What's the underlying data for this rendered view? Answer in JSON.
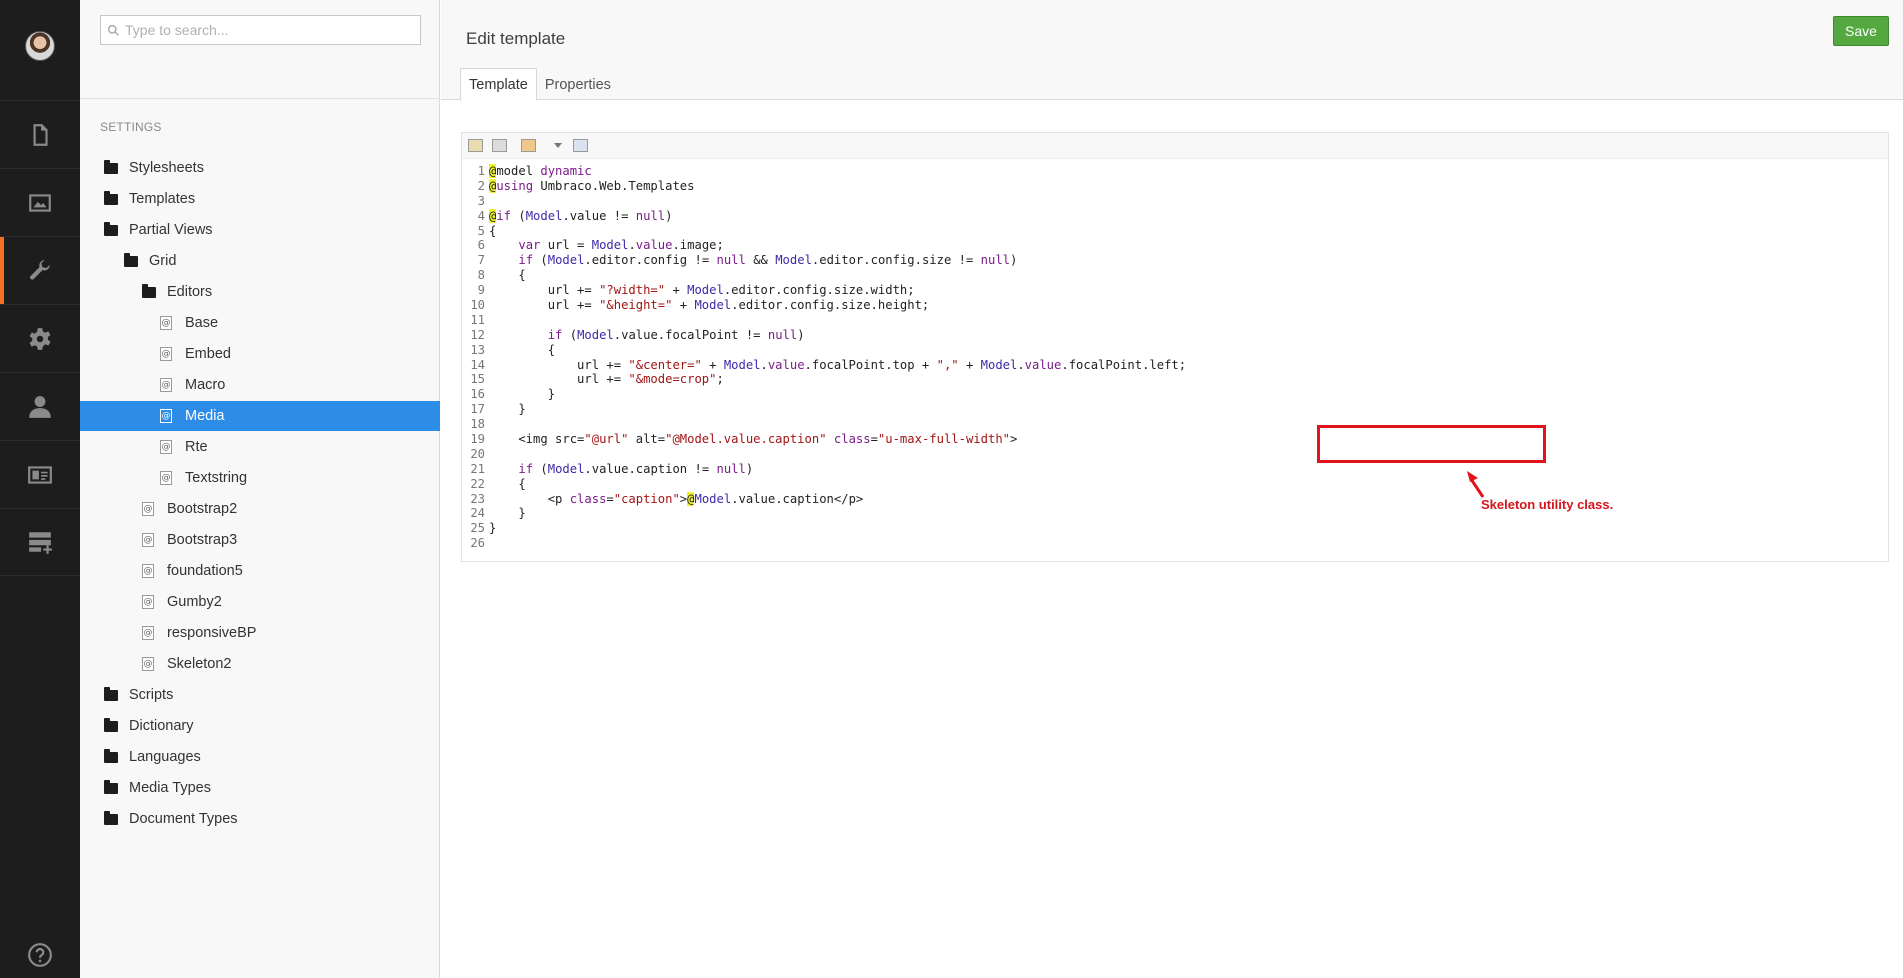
{
  "rail": {
    "items": [
      {
        "name": "content-icon"
      },
      {
        "name": "media-icon"
      },
      {
        "name": "settings-wrench-icon"
      },
      {
        "name": "developer-gear-icon"
      },
      {
        "name": "users-icon"
      },
      {
        "name": "members-icon"
      },
      {
        "name": "forms-icon"
      }
    ],
    "active_index": 2,
    "help_icon": "help-icon",
    "accent_color": "#f36f21"
  },
  "tree": {
    "search_placeholder": "Type to search...",
    "section_title": "SETTINGS",
    "items": [
      {
        "label": "Stylesheets",
        "type": "folder",
        "depth": 0
      },
      {
        "label": "Templates",
        "type": "folder",
        "depth": 0
      },
      {
        "label": "Partial Views",
        "type": "folder",
        "depth": 0
      },
      {
        "label": "Grid",
        "type": "folder",
        "depth": 1
      },
      {
        "label": "Editors",
        "type": "folder",
        "depth": 2
      },
      {
        "label": "Base",
        "type": "file",
        "depth": 3
      },
      {
        "label": "Embed",
        "type": "file",
        "depth": 3
      },
      {
        "label": "Macro",
        "type": "file",
        "depth": 3
      },
      {
        "label": "Media",
        "type": "file",
        "depth": 3,
        "selected": true
      },
      {
        "label": "Rte",
        "type": "file",
        "depth": 3
      },
      {
        "label": "Textstring",
        "type": "file",
        "depth": 3
      },
      {
        "label": "Bootstrap2",
        "type": "file",
        "depth": 2
      },
      {
        "label": "Bootstrap3",
        "type": "file",
        "depth": 2
      },
      {
        "label": "foundation5",
        "type": "file",
        "depth": 2
      },
      {
        "label": "Gumby2",
        "type": "file",
        "depth": 2
      },
      {
        "label": "responsiveBP",
        "type": "file",
        "depth": 2
      },
      {
        "label": "Skeleton2",
        "type": "file",
        "depth": 2
      },
      {
        "label": "Scripts",
        "type": "folder",
        "depth": 0
      },
      {
        "label": "Dictionary",
        "type": "folder",
        "depth": 0
      },
      {
        "label": "Languages",
        "type": "folder",
        "depth": 0
      },
      {
        "label": "Media Types",
        "type": "folder",
        "depth": 0
      },
      {
        "label": "Document Types",
        "type": "folder",
        "depth": 0
      }
    ],
    "selected_color": "#2d8ce6"
  },
  "header": {
    "title": "Edit template",
    "save_label": "Save",
    "save_color": "#53a93f",
    "tabs": [
      {
        "label": "Template",
        "active": true
      },
      {
        "label": "Properties",
        "active": false
      }
    ]
  },
  "editor": {
    "toolbar_icons": [
      "insert-page-field-icon",
      "insert-macro-icon",
      "insert-dictionary-icon",
      "dropdown-arrow-icon",
      "query-builder-icon"
    ],
    "lines": [
      [
        [
          "at",
          "@"
        ],
        [
          "",
          "model "
        ],
        [
          "kw",
          "dynamic"
        ]
      ],
      [
        [
          "at",
          "@"
        ],
        [
          "kw",
          "using"
        ],
        [
          "",
          " Umbraco.Web.Templates"
        ]
      ],
      [],
      [
        [
          "at",
          "@"
        ],
        [
          "kw",
          "if"
        ],
        [
          "",
          " ("
        ],
        [
          "var",
          "Model"
        ],
        [
          "",
          ".value != "
        ],
        [
          "kw",
          "null"
        ],
        [
          "",
          ")"
        ]
      ],
      [
        [
          "",
          "{"
        ]
      ],
      [
        [
          "",
          "    "
        ],
        [
          "kw",
          "var"
        ],
        [
          "",
          " url = "
        ],
        [
          "var",
          "Model"
        ],
        [
          "",
          "."
        ],
        [
          "kw",
          "value"
        ],
        [
          "",
          ".image;"
        ]
      ],
      [
        [
          "",
          "    "
        ],
        [
          "kw",
          "if"
        ],
        [
          "",
          " ("
        ],
        [
          "var",
          "Model"
        ],
        [
          "",
          ".editor.config != "
        ],
        [
          "kw",
          "null"
        ],
        [
          "",
          " && "
        ],
        [
          "var",
          "Model"
        ],
        [
          "",
          ".editor.config.size != "
        ],
        [
          "kw",
          "null"
        ],
        [
          "",
          ")"
        ]
      ],
      [
        [
          "",
          "    {"
        ]
      ],
      [
        [
          "",
          "        url += "
        ],
        [
          "str",
          "\"?width=\""
        ],
        [
          "",
          " + "
        ],
        [
          "var",
          "Model"
        ],
        [
          "",
          ".editor.config.size.width;"
        ]
      ],
      [
        [
          "",
          "        url += "
        ],
        [
          "str",
          "\"&height=\""
        ],
        [
          "",
          " + "
        ],
        [
          "var",
          "Model"
        ],
        [
          "",
          ".editor.config.size.height;"
        ]
      ],
      [],
      [
        [
          "",
          "        "
        ],
        [
          "kw",
          "if"
        ],
        [
          "",
          " ("
        ],
        [
          "var",
          "Model"
        ],
        [
          "",
          ".value.focalPoint != "
        ],
        [
          "kw",
          "null"
        ],
        [
          "",
          ")"
        ]
      ],
      [
        [
          "",
          "        {"
        ]
      ],
      [
        [
          "",
          "            url += "
        ],
        [
          "str",
          "\"&center=\""
        ],
        [
          "",
          " + "
        ],
        [
          "var",
          "Model"
        ],
        [
          "",
          "."
        ],
        [
          "kw",
          "value"
        ],
        [
          "",
          ".focalPoint.top + "
        ],
        [
          "str",
          "\",\""
        ],
        [
          "",
          " + "
        ],
        [
          "var",
          "Model"
        ],
        [
          "",
          "."
        ],
        [
          "kw",
          "value"
        ],
        [
          "",
          ".focalPoint.left;"
        ]
      ],
      [
        [
          "",
          "            url += "
        ],
        [
          "str",
          "\"&mode=crop\""
        ],
        [
          "",
          ";"
        ]
      ],
      [
        [
          "",
          "        }"
        ]
      ],
      [
        [
          "",
          "    }"
        ]
      ],
      [],
      [
        [
          "",
          "    <img src="
        ],
        [
          "str",
          "\"@url\""
        ],
        [
          "",
          " alt="
        ],
        [
          "str",
          "\"@Model.value.caption\""
        ],
        [
          "",
          " "
        ],
        [
          "kw",
          "class"
        ],
        [
          "",
          "="
        ],
        [
          "str",
          "\"u-max-full-width\""
        ],
        [
          "",
          ">"
        ]
      ],
      [],
      [
        [
          "",
          "    "
        ],
        [
          "kw",
          "if"
        ],
        [
          "",
          " ("
        ],
        [
          "var",
          "Model"
        ],
        [
          "",
          ".value.caption != "
        ],
        [
          "kw",
          "null"
        ],
        [
          "",
          ")"
        ]
      ],
      [
        [
          "",
          "    {"
        ]
      ],
      [
        [
          "",
          "        <p "
        ],
        [
          "kw",
          "class"
        ],
        [
          "",
          "="
        ],
        [
          "str",
          "\"caption\""
        ],
        [
          "",
          ">"
        ],
        [
          "at",
          "@"
        ],
        [
          "var",
          "Model"
        ],
        [
          "",
          ".value.caption</p>"
        ]
      ],
      [
        [
          "",
          "    }"
        ]
      ],
      [
        [
          "",
          "}"
        ]
      ],
      []
    ]
  },
  "annotation": {
    "text": "Skeleton utility class.",
    "color": "#e3131b"
  }
}
